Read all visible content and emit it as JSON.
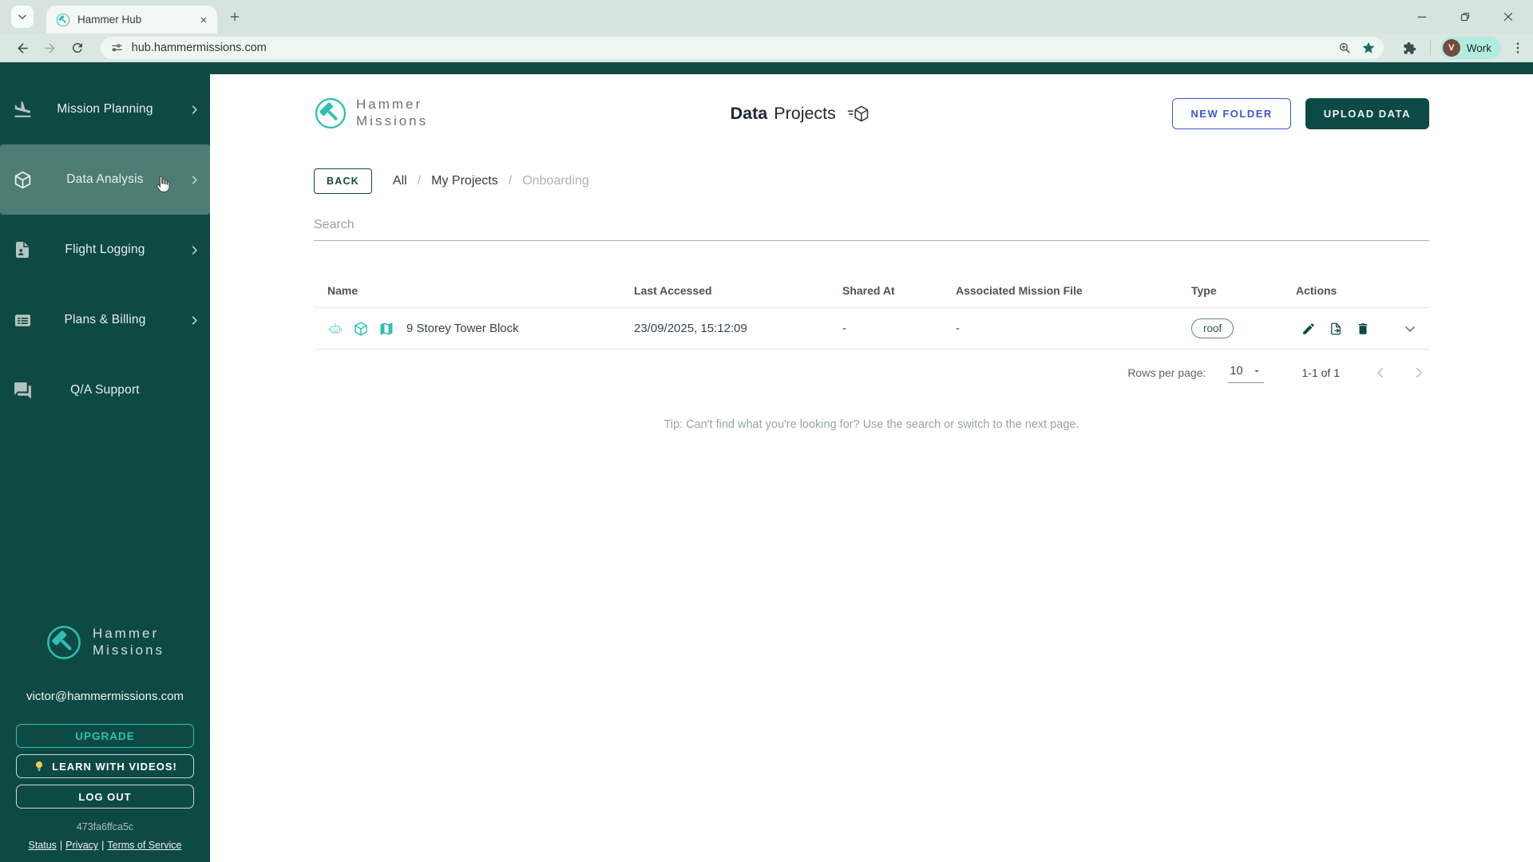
{
  "browser": {
    "tab_title": "Hammer Hub",
    "url": "hub.hammermissions.com",
    "profile_initial": "V",
    "profile_label": "Work"
  },
  "sidebar": {
    "items": [
      {
        "label": "Mission Planning",
        "icon": "flight-land-icon",
        "chevron": true,
        "active": false
      },
      {
        "label": "Data Analysis",
        "icon": "cube-icon",
        "chevron": true,
        "active": true
      },
      {
        "label": "Flight Logging",
        "icon": "flight-log-document-icon",
        "chevron": true,
        "active": false
      },
      {
        "label": "Plans & Billing",
        "icon": "billing-card-icon",
        "chevron": true,
        "active": false
      },
      {
        "label": "Q/A Support",
        "icon": "chat-icon",
        "chevron": false,
        "active": false
      }
    ],
    "brand": {
      "line1": "Hammer",
      "line2": "Missions"
    },
    "email": "victor@hammermissions.com",
    "buttons": {
      "upgrade": "UPGRADE",
      "learn": "LEARN WITH VIDEOS!",
      "logout": "LOG OUT"
    },
    "build_id": "473fa6ffca5c",
    "footer_links": [
      "Status",
      "Privacy",
      "Terms of Service"
    ],
    "footer_sep": "|"
  },
  "header": {
    "brand": {
      "line1": "Hammer",
      "line2": "Missions"
    },
    "title_bold": "Data",
    "title_regular": "Projects",
    "new_folder": "NEW FOLDER",
    "upload_data": "UPLOAD DATA"
  },
  "breadcrumb": {
    "back": "BACK",
    "separator": "/",
    "items": [
      {
        "label": "All",
        "current": false
      },
      {
        "label": "My Projects",
        "current": false
      },
      {
        "label": "Onboarding",
        "current": true
      }
    ]
  },
  "search": {
    "placeholder": "Search"
  },
  "table": {
    "columns": [
      "Name",
      "Last Accessed",
      "Shared At",
      "Associated Mission File",
      "Type",
      "Actions"
    ],
    "rows": [
      {
        "name": "9 Storey Tower Block",
        "last_accessed": "23/09/2025, 15:12:09",
        "shared_at": "-",
        "associated_mission_file": "-",
        "type": "roof"
      }
    ]
  },
  "pagination": {
    "rows_per_page_label": "Rows per page:",
    "rows_per_page": "10",
    "range": "1-1 of 1"
  },
  "tip": "Tip: Can't find what you're looking for? Use the search or switch to the next page.",
  "colors": {
    "sidebar_teal": "#0e4a44",
    "active_item_teal": "#4e7d76",
    "accent_teal": "#2cbfb5",
    "button_blue": "#3d58d6",
    "chip_teal": "#27584f",
    "chrome_bg": "#d6e3de"
  }
}
